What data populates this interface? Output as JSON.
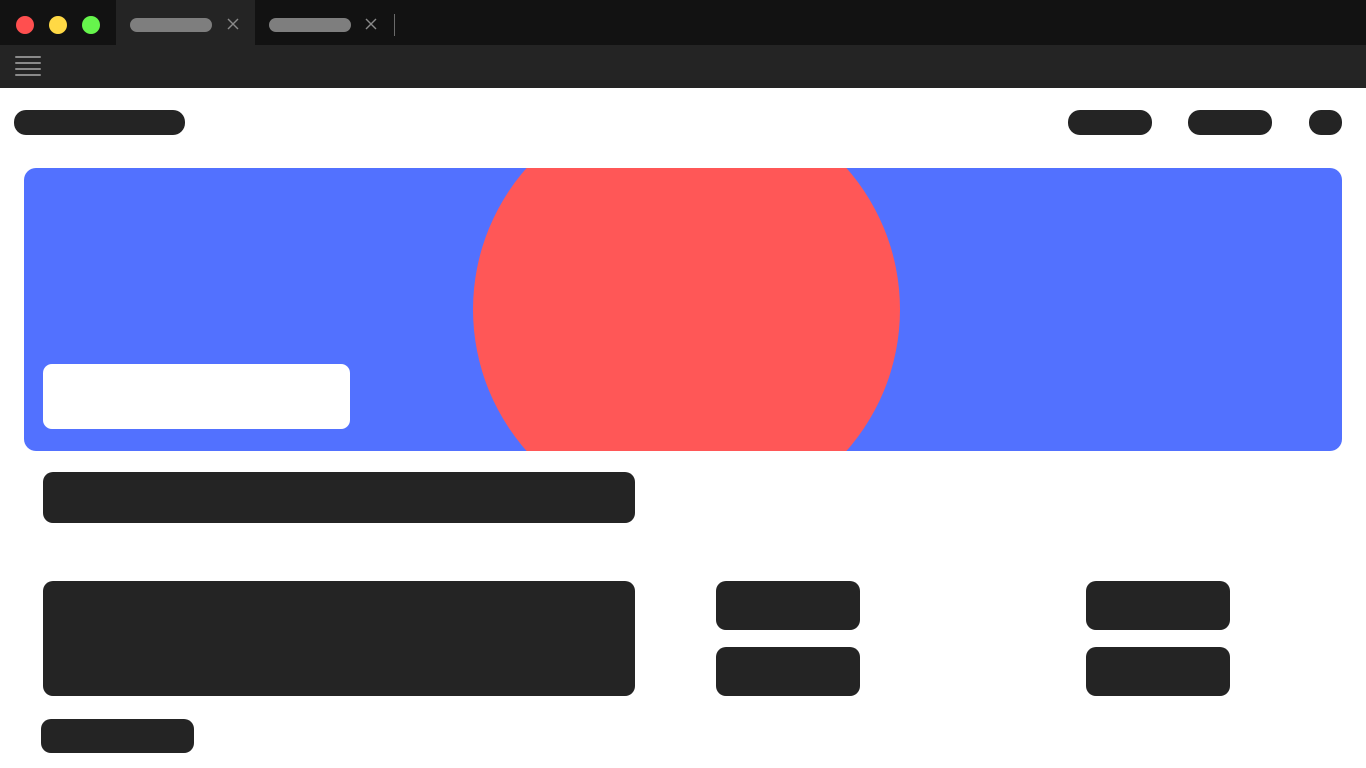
{
  "window": {
    "traffic_lights": {
      "close_color": "#ff4f4f",
      "minimize_color": "#ffd945",
      "zoom_color": "#66f54c"
    },
    "tabs": [
      {
        "label": "",
        "active": true
      },
      {
        "label": "",
        "active": false
      }
    ]
  },
  "toolbar": {
    "menu_icon": "hamburger-menu-icon"
  },
  "header": {
    "logo_text": "",
    "nav_items": [
      "",
      "",
      ""
    ]
  },
  "hero": {
    "background_color": "#5271ff",
    "shape_color": "#ff5757",
    "card_text": ""
  },
  "main": {
    "heading": "",
    "description": "",
    "link_buttons": [
      "",
      "",
      "",
      ""
    ],
    "footer_button": ""
  }
}
